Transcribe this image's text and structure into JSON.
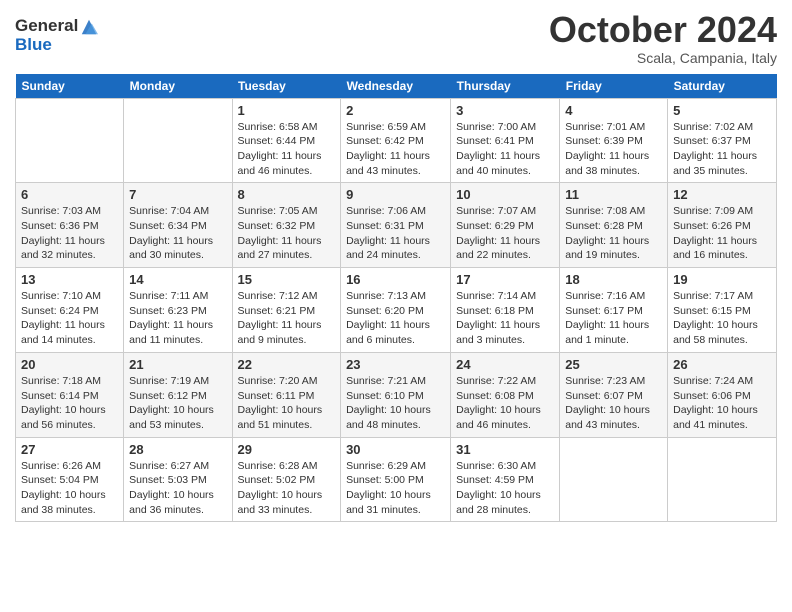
{
  "logo": {
    "general": "General",
    "blue": "Blue"
  },
  "title": "October 2024",
  "location": "Scala, Campania, Italy",
  "days_header": [
    "Sunday",
    "Monday",
    "Tuesday",
    "Wednesday",
    "Thursday",
    "Friday",
    "Saturday"
  ],
  "weeks": [
    [
      {
        "day": "",
        "sunrise": "",
        "sunset": "",
        "daylight": ""
      },
      {
        "day": "",
        "sunrise": "",
        "sunset": "",
        "daylight": ""
      },
      {
        "day": "1",
        "sunrise": "Sunrise: 6:58 AM",
        "sunset": "Sunset: 6:44 PM",
        "daylight": "Daylight: 11 hours and 46 minutes."
      },
      {
        "day": "2",
        "sunrise": "Sunrise: 6:59 AM",
        "sunset": "Sunset: 6:42 PM",
        "daylight": "Daylight: 11 hours and 43 minutes."
      },
      {
        "day": "3",
        "sunrise": "Sunrise: 7:00 AM",
        "sunset": "Sunset: 6:41 PM",
        "daylight": "Daylight: 11 hours and 40 minutes."
      },
      {
        "day": "4",
        "sunrise": "Sunrise: 7:01 AM",
        "sunset": "Sunset: 6:39 PM",
        "daylight": "Daylight: 11 hours and 38 minutes."
      },
      {
        "day": "5",
        "sunrise": "Sunrise: 7:02 AM",
        "sunset": "Sunset: 6:37 PM",
        "daylight": "Daylight: 11 hours and 35 minutes."
      }
    ],
    [
      {
        "day": "6",
        "sunrise": "Sunrise: 7:03 AM",
        "sunset": "Sunset: 6:36 PM",
        "daylight": "Daylight: 11 hours and 32 minutes."
      },
      {
        "day": "7",
        "sunrise": "Sunrise: 7:04 AM",
        "sunset": "Sunset: 6:34 PM",
        "daylight": "Daylight: 11 hours and 30 minutes."
      },
      {
        "day": "8",
        "sunrise": "Sunrise: 7:05 AM",
        "sunset": "Sunset: 6:32 PM",
        "daylight": "Daylight: 11 hours and 27 minutes."
      },
      {
        "day": "9",
        "sunrise": "Sunrise: 7:06 AM",
        "sunset": "Sunset: 6:31 PM",
        "daylight": "Daylight: 11 hours and 24 minutes."
      },
      {
        "day": "10",
        "sunrise": "Sunrise: 7:07 AM",
        "sunset": "Sunset: 6:29 PM",
        "daylight": "Daylight: 11 hours and 22 minutes."
      },
      {
        "day": "11",
        "sunrise": "Sunrise: 7:08 AM",
        "sunset": "Sunset: 6:28 PM",
        "daylight": "Daylight: 11 hours and 19 minutes."
      },
      {
        "day": "12",
        "sunrise": "Sunrise: 7:09 AM",
        "sunset": "Sunset: 6:26 PM",
        "daylight": "Daylight: 11 hours and 16 minutes."
      }
    ],
    [
      {
        "day": "13",
        "sunrise": "Sunrise: 7:10 AM",
        "sunset": "Sunset: 6:24 PM",
        "daylight": "Daylight: 11 hours and 14 minutes."
      },
      {
        "day": "14",
        "sunrise": "Sunrise: 7:11 AM",
        "sunset": "Sunset: 6:23 PM",
        "daylight": "Daylight: 11 hours and 11 minutes."
      },
      {
        "day": "15",
        "sunrise": "Sunrise: 7:12 AM",
        "sunset": "Sunset: 6:21 PM",
        "daylight": "Daylight: 11 hours and 9 minutes."
      },
      {
        "day": "16",
        "sunrise": "Sunrise: 7:13 AM",
        "sunset": "Sunset: 6:20 PM",
        "daylight": "Daylight: 11 hours and 6 minutes."
      },
      {
        "day": "17",
        "sunrise": "Sunrise: 7:14 AM",
        "sunset": "Sunset: 6:18 PM",
        "daylight": "Daylight: 11 hours and 3 minutes."
      },
      {
        "day": "18",
        "sunrise": "Sunrise: 7:16 AM",
        "sunset": "Sunset: 6:17 PM",
        "daylight": "Daylight: 11 hours and 1 minute."
      },
      {
        "day": "19",
        "sunrise": "Sunrise: 7:17 AM",
        "sunset": "Sunset: 6:15 PM",
        "daylight": "Daylight: 10 hours and 58 minutes."
      }
    ],
    [
      {
        "day": "20",
        "sunrise": "Sunrise: 7:18 AM",
        "sunset": "Sunset: 6:14 PM",
        "daylight": "Daylight: 10 hours and 56 minutes."
      },
      {
        "day": "21",
        "sunrise": "Sunrise: 7:19 AM",
        "sunset": "Sunset: 6:12 PM",
        "daylight": "Daylight: 10 hours and 53 minutes."
      },
      {
        "day": "22",
        "sunrise": "Sunrise: 7:20 AM",
        "sunset": "Sunset: 6:11 PM",
        "daylight": "Daylight: 10 hours and 51 minutes."
      },
      {
        "day": "23",
        "sunrise": "Sunrise: 7:21 AM",
        "sunset": "Sunset: 6:10 PM",
        "daylight": "Daylight: 10 hours and 48 minutes."
      },
      {
        "day": "24",
        "sunrise": "Sunrise: 7:22 AM",
        "sunset": "Sunset: 6:08 PM",
        "daylight": "Daylight: 10 hours and 46 minutes."
      },
      {
        "day": "25",
        "sunrise": "Sunrise: 7:23 AM",
        "sunset": "Sunset: 6:07 PM",
        "daylight": "Daylight: 10 hours and 43 minutes."
      },
      {
        "day": "26",
        "sunrise": "Sunrise: 7:24 AM",
        "sunset": "Sunset: 6:06 PM",
        "daylight": "Daylight: 10 hours and 41 minutes."
      }
    ],
    [
      {
        "day": "27",
        "sunrise": "Sunrise: 6:26 AM",
        "sunset": "Sunset: 5:04 PM",
        "daylight": "Daylight: 10 hours and 38 minutes."
      },
      {
        "day": "28",
        "sunrise": "Sunrise: 6:27 AM",
        "sunset": "Sunset: 5:03 PM",
        "daylight": "Daylight: 10 hours and 36 minutes."
      },
      {
        "day": "29",
        "sunrise": "Sunrise: 6:28 AM",
        "sunset": "Sunset: 5:02 PM",
        "daylight": "Daylight: 10 hours and 33 minutes."
      },
      {
        "day": "30",
        "sunrise": "Sunrise: 6:29 AM",
        "sunset": "Sunset: 5:00 PM",
        "daylight": "Daylight: 10 hours and 31 minutes."
      },
      {
        "day": "31",
        "sunrise": "Sunrise: 6:30 AM",
        "sunset": "Sunset: 4:59 PM",
        "daylight": "Daylight: 10 hours and 28 minutes."
      },
      {
        "day": "",
        "sunrise": "",
        "sunset": "",
        "daylight": ""
      },
      {
        "day": "",
        "sunrise": "",
        "sunset": "",
        "daylight": ""
      }
    ]
  ]
}
